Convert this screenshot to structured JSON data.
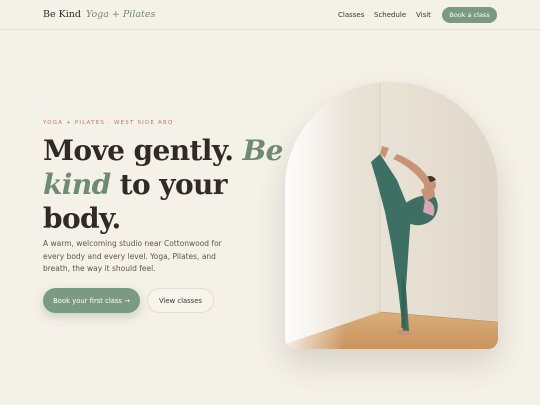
{
  "header": {
    "brand_name": "Be Kind",
    "brand_accent": "Yoga + Pilates",
    "nav": [
      "Classes",
      "Schedule",
      "Visit"
    ],
    "cta": "Book a class"
  },
  "hero": {
    "eyebrow": "YOGA + PILATES · WEST SIDE ABQ",
    "headline_part1": "Move gently. ",
    "headline_highlight": "Be kind",
    "headline_part2": " to your body.",
    "subtext": "A warm, welcoming studio near Cottonwood for every body and every level. Yoga, Pilates, and breath, the way it should feel.",
    "primary_button": "Book your first class →",
    "secondary_button": "View classes"
  },
  "colors": {
    "background": "#f4f1e8",
    "sage": "#7b9a84",
    "accent_terracotta": "#c07a5a",
    "text": "#2f2a26"
  }
}
